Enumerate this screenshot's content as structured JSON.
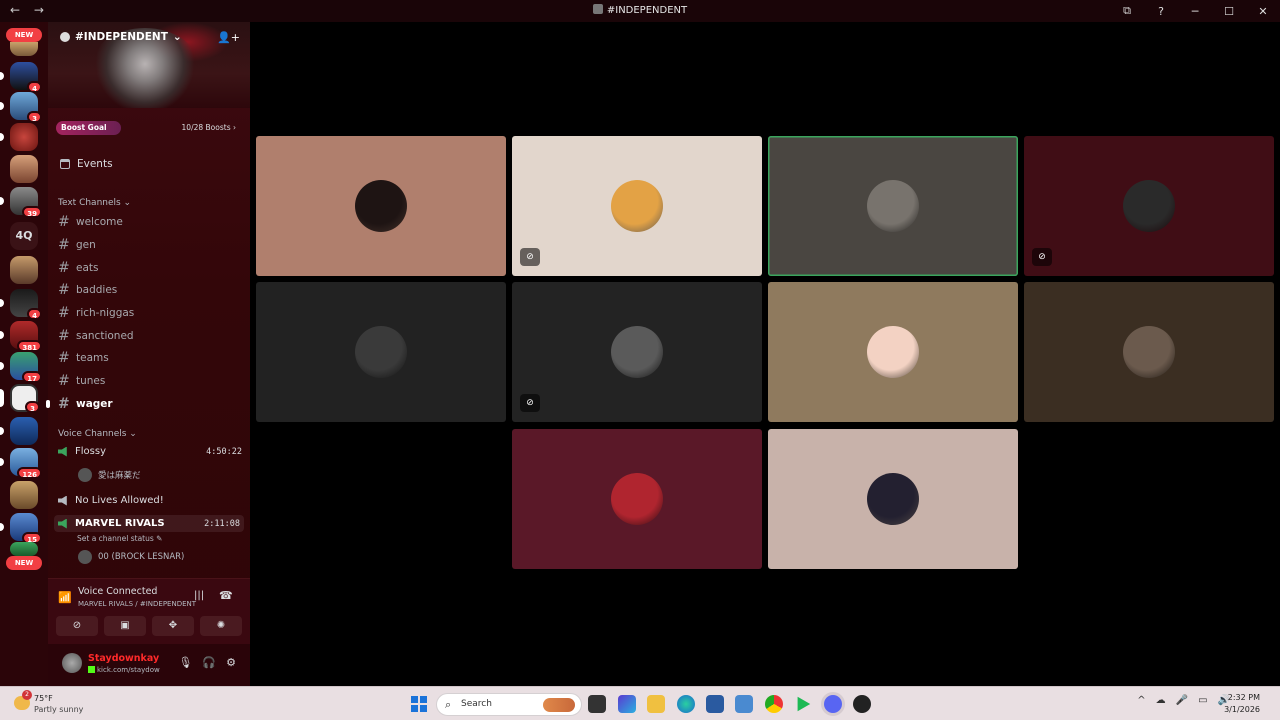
{
  "window": {
    "title": "#INDEPENDENT",
    "nav_back": "←",
    "nav_forward": "→",
    "controls": [
      "⧉",
      "?",
      "─",
      "☐",
      "✕"
    ]
  },
  "server_rail": {
    "new_top": "NEW",
    "new_bottom": "NEW",
    "text_server": "4Q",
    "badges": {
      "b1": "4",
      "b2": "3",
      "b3": "39",
      "b4": "4",
      "b5": "381",
      "b6": "17",
      "b7": "3",
      "b8": "126",
      "b9": "15"
    }
  },
  "sidebar": {
    "server_name": "#INDEPENDENT",
    "server_chevron": "⌄",
    "invite_icon": "👤+",
    "boost_goal": "Boost Goal",
    "boost_count": "10/28 Boosts ›",
    "events_label": "Events",
    "text_category": "Text Channels ⌄",
    "text_channels": [
      "welcome",
      "gen",
      "eats",
      "baddies",
      "rich-niggas",
      "sanctioned",
      "teams",
      "tunes",
      "wager"
    ],
    "voice_category": "Voice Channels ⌄",
    "voice_channels": [
      {
        "name": "Flossy",
        "time": "4:50:22"
      },
      {
        "name": "No Lives Allowed!",
        "time": ""
      },
      {
        "name": "MARVEL RIVALS",
        "time": "2:11:08"
      }
    ],
    "flossy_member": "愛は麻薬だ",
    "channel_status": "Set a channel status ✎",
    "marvel_member": "00 (BROCK LESNAR)"
  },
  "voice_panel": {
    "title": "Voice Connected",
    "subtitle": "MARVEL RIVALS / #INDEPENDENT"
  },
  "user_panel": {
    "username": "Staydownkay",
    "status": "kick.com/staydow"
  },
  "tiles": [
    {
      "bg": "#b07f6d",
      "avatar": "#1e1413",
      "speaking": false,
      "muted": false
    },
    {
      "bg": "#e2d6cc",
      "avatar": "#e3a245",
      "speaking": false,
      "muted": true
    },
    {
      "bg": "#4a4641",
      "avatar": "#78736d",
      "speaking": true,
      "muted": false
    },
    {
      "bg": "#400d15",
      "avatar": "#2a2a2a",
      "speaking": false,
      "muted": true
    },
    {
      "bg": "#222222",
      "avatar": "#3a3a3a",
      "speaking": false,
      "muted": false
    },
    {
      "bg": "#232323",
      "avatar": "#5a5a5a",
      "speaking": false,
      "muted": true
    },
    {
      "bg": "#8f7a5e",
      "avatar": "#f3d2c3",
      "speaking": false,
      "muted": false
    },
    {
      "bg": "#3b2e22",
      "avatar": "#6b5a4d",
      "speaking": false,
      "muted": false
    },
    {
      "bg": "#5a1828",
      "avatar": "#b0252f",
      "speaking": false,
      "muted": false
    },
    {
      "bg": "#c8b2aa",
      "avatar": "#232030",
      "speaking": false,
      "muted": false
    }
  ],
  "taskbar": {
    "temp": "75°F",
    "weather": "Partly sunny",
    "weather_badge": "2",
    "search_placeholder": "Search",
    "time": "2:32 PM",
    "date": "3/1/2026",
    "tray_icons": [
      "^",
      "☁",
      "🎤",
      "▭",
      "🔊"
    ]
  }
}
